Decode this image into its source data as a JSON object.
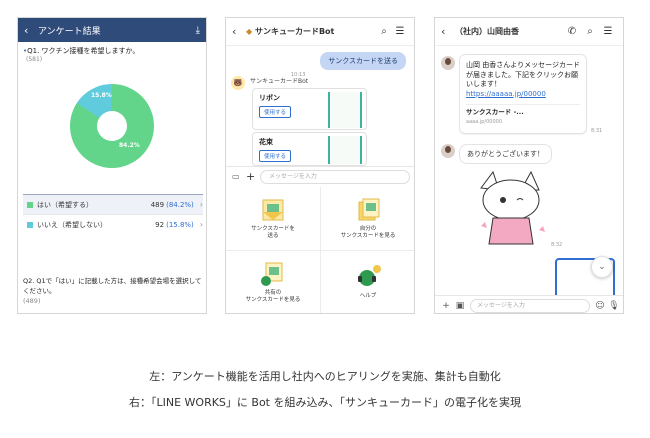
{
  "survey": {
    "header_title": "アンケート結果",
    "question1": "Q1. ワクチン接種を希望しますか。",
    "question1_count": "(581)",
    "pie_label_big": "84.2%",
    "pie_label_small": "15.8%",
    "yes_share": 0.842,
    "options": [
      {
        "label": "はい（希望する）",
        "count": "489",
        "pct": "(84.2%)",
        "color": "#62d58a"
      },
      {
        "label": "いいえ（希望しない）",
        "count": "92",
        "pct": "(15.8%)",
        "color": "#5fcbdc"
      }
    ],
    "question2": "Q2. Q1で「はい」に記載した方は、接種希望会場を選択してください。",
    "question2_count": "(489)"
  },
  "bot": {
    "header_title": "サンキューカードBot",
    "outgoing": "サンクスカードを送る",
    "time1": "10:13",
    "bot_name": "サンキューカードBot",
    "cards": [
      {
        "name": "リボン",
        "use": "使用する"
      },
      {
        "name": "花束",
        "use": "使用する"
      }
    ],
    "input_placeholder": "メッセージを入力",
    "menu": [
      {
        "label": "サンクスカードを\n送る"
      },
      {
        "label": "自分の\nサンクスカードを見る"
      },
      {
        "label": "共有の\nサンクスカードを見る"
      },
      {
        "label": "ヘルプ"
      }
    ]
  },
  "chat": {
    "header_title": "（社内）山岡由香",
    "message": "山岡 由香さんよりメッセージカードが届きました。下記をクリックお願いします！",
    "link": "https://aaaaa.jp/00000",
    "preview_title": "サンクスカード -...",
    "preview_url": "aaaa.jp/00000",
    "time1": "8:31",
    "thanks": "ありがとうございます！",
    "time2": "8:32",
    "input_placeholder": "メッセージを入力"
  },
  "captions": {
    "line1": "左：アンケート機能を活用し社内へのヒアリングを実施、集計も自動化",
    "line2": "右：「LINE WORKS」に Bot を組み込み、「サンキューカード」の電子化を実現"
  }
}
